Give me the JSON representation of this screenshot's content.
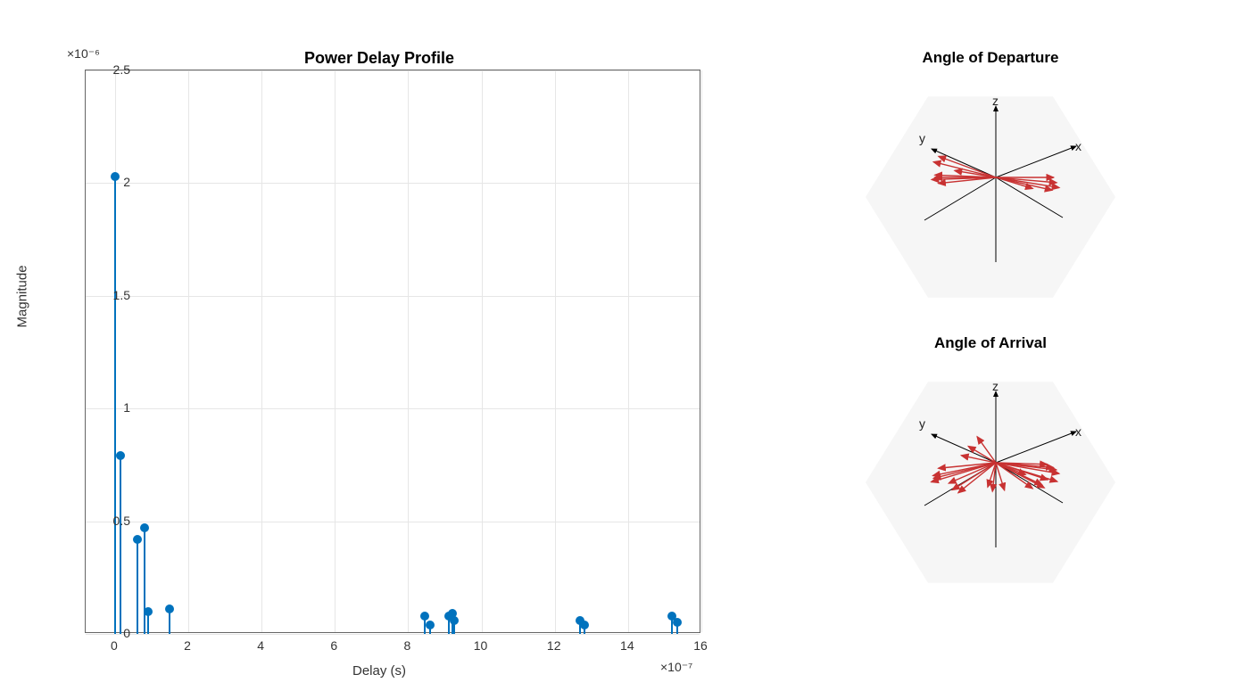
{
  "chart_data": {
    "type": "stem",
    "title": "Power Delay Profile",
    "xlabel": "Delay (s)",
    "ylabel": "Magnitude",
    "x_exponent": "×10⁻⁷",
    "y_exponent": "×10⁻⁶",
    "xlim": [
      -0.8,
      16
    ],
    "ylim": [
      0,
      2.5
    ],
    "x_ticks": [
      0,
      2,
      4,
      6,
      8,
      10,
      12,
      14,
      16
    ],
    "y_ticks": [
      0,
      0.5,
      1,
      1.5,
      2,
      2.5
    ],
    "points": [
      {
        "x": 0.0,
        "y": 2.03
      },
      {
        "x": 0.15,
        "y": 0.79
      },
      {
        "x": 0.6,
        "y": 0.42
      },
      {
        "x": 0.8,
        "y": 0.47
      },
      {
        "x": 0.9,
        "y": 0.1
      },
      {
        "x": 1.5,
        "y": 0.11
      },
      {
        "x": 8.45,
        "y": 0.08
      },
      {
        "x": 8.6,
        "y": 0.04
      },
      {
        "x": 9.1,
        "y": 0.08
      },
      {
        "x": 9.2,
        "y": 0.09
      },
      {
        "x": 9.25,
        "y": 0.06
      },
      {
        "x": 12.7,
        "y": 0.06
      },
      {
        "x": 12.8,
        "y": 0.04
      },
      {
        "x": 15.2,
        "y": 0.08
      },
      {
        "x": 15.35,
        "y": 0.05
      }
    ]
  },
  "right_plots": {
    "departure": {
      "title": "Angle of Departure",
      "axes": {
        "x": "x",
        "y": "y",
        "z": "z"
      },
      "arrows": [
        {
          "dx": 62,
          "dy": 10,
          "len": 1.0
        },
        {
          "dx": 58,
          "dy": 5,
          "len": 0.95
        },
        {
          "dx": 50,
          "dy": 0,
          "len": 0.9
        },
        {
          "dx": 40,
          "dy": 12,
          "len": 0.6
        },
        {
          "dx": 66,
          "dy": 15,
          "len": 0.9
        },
        {
          "dx": -38,
          "dy": -14,
          "len": 0.95
        },
        {
          "dx": -40,
          "dy": -10,
          "len": 1.0
        },
        {
          "dx": -50,
          "dy": -2,
          "len": 0.95
        },
        {
          "dx": -55,
          "dy": 0,
          "len": 0.95
        },
        {
          "dx": -58,
          "dy": 6,
          "len": 0.9
        },
        {
          "dx": -36,
          "dy": -6,
          "len": 0.65
        },
        {
          "dx": -60,
          "dy": 2,
          "len": 1.0
        }
      ]
    },
    "arrival": {
      "title": "Angle of Arrival",
      "axes": {
        "x": "x",
        "y": "y",
        "z": "z"
      },
      "arrows": [
        {
          "dx": 70,
          "dy": 12,
          "len": 1.0
        },
        {
          "dx": 72,
          "dy": 22,
          "len": 1.0
        },
        {
          "dx": 60,
          "dy": 5,
          "len": 0.9
        },
        {
          "dx": 55,
          "dy": 18,
          "len": 0.85
        },
        {
          "dx": 64,
          "dy": 2,
          "len": 0.8
        },
        {
          "dx": 68,
          "dy": 8,
          "len": 0.95
        },
        {
          "dx": 50,
          "dy": 24,
          "len": 0.8
        },
        {
          "dx": 40,
          "dy": 28,
          "len": 0.7
        },
        {
          "dx": 35,
          "dy": 14,
          "len": 0.5
        },
        {
          "dx": 58,
          "dy": 30,
          "len": 0.85
        },
        {
          "dx": 10,
          "dy": 32,
          "len": 0.45
        },
        {
          "dx": -4,
          "dy": 34,
          "len": 0.45
        },
        {
          "dx": -10,
          "dy": 30,
          "len": 0.4
        },
        {
          "dx": -20,
          "dy": -28,
          "len": 0.5
        },
        {
          "dx": -30,
          "dy": -18,
          "len": 0.5
        },
        {
          "dx": -38,
          "dy": -8,
          "len": 0.55
        },
        {
          "dx": -62,
          "dy": 6,
          "len": 0.9
        },
        {
          "dx": -68,
          "dy": 14,
          "len": 1.0
        },
        {
          "dx": -72,
          "dy": 18,
          "len": 1.0
        },
        {
          "dx": -74,
          "dy": 22,
          "len": 1.05
        },
        {
          "dx": -55,
          "dy": 24,
          "len": 0.8
        },
        {
          "dx": -48,
          "dy": 30,
          "len": 0.8
        },
        {
          "dx": -40,
          "dy": 32,
          "len": 0.75
        }
      ]
    }
  },
  "colors": {
    "stem": "#0072bd",
    "arrow": "#c83232",
    "hex_bg": "#f6f6f6",
    "grid": "#e6e6e6"
  }
}
